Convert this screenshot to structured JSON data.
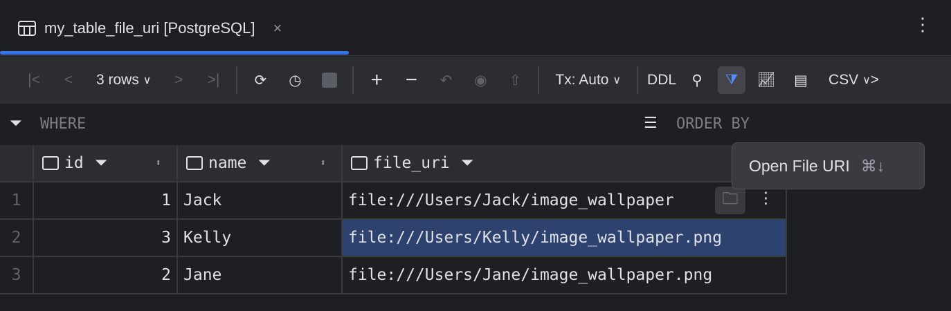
{
  "tab": {
    "title": "my_table_file_uri [PostgreSQL]",
    "close": "×"
  },
  "toolbar": {
    "rows": "3 rows",
    "tx": "Tx: Auto",
    "ddl": "DDL",
    "csv": "CSV"
  },
  "filter": {
    "where": "WHERE",
    "order_by": "ORDER BY"
  },
  "columns": [
    "id",
    "name",
    "file_uri"
  ],
  "rows": [
    {
      "n": "1",
      "id": "1",
      "name": "Jack",
      "file_uri": "file:///Users/Jack/image_wallpaper"
    },
    {
      "n": "2",
      "id": "3",
      "name": "Kelly",
      "file_uri": "file:///Users/Kelly/image_wallpaper.png"
    },
    {
      "n": "3",
      "id": "2",
      "name": "Jane",
      "file_uri": "file:///Users/Jane/image_wallpaper.png"
    }
  ],
  "popup": {
    "label": "Open File URI",
    "shortcut": "⌘↓"
  },
  "colors": {
    "accent": "#3574f0",
    "selection": "#2e4270"
  }
}
